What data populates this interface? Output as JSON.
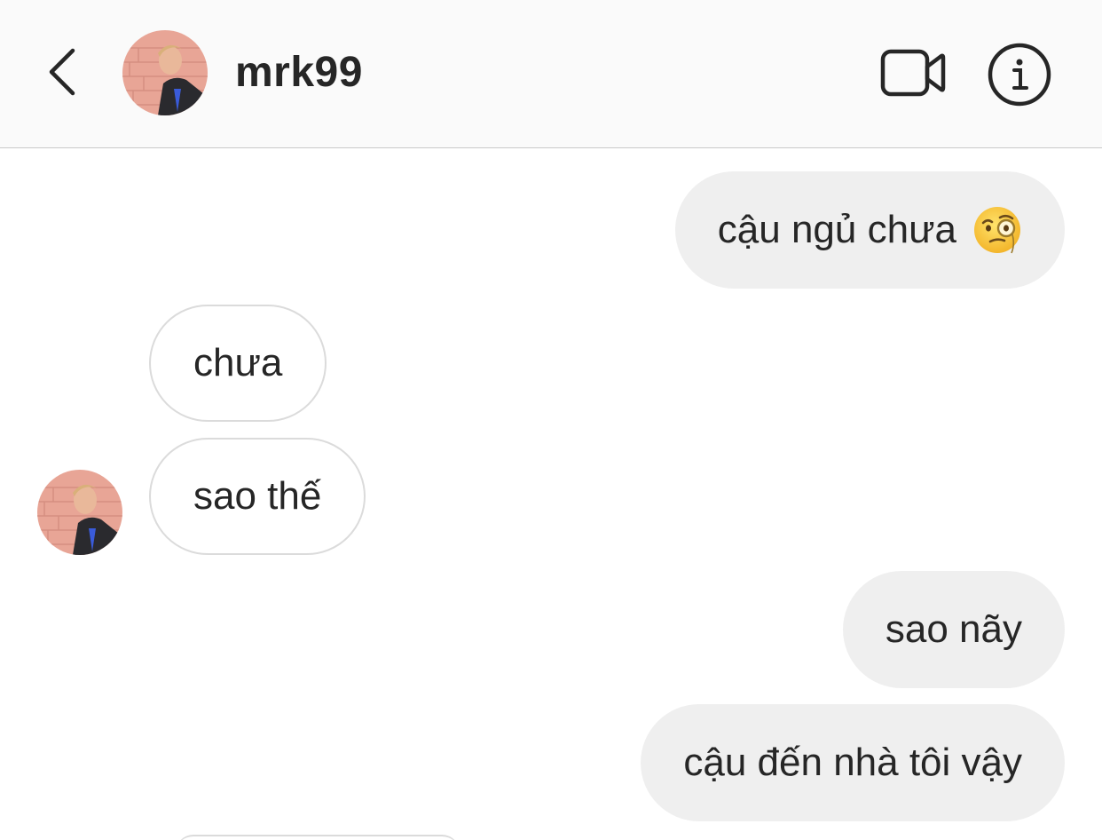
{
  "header": {
    "username": "mrk99",
    "back_icon": "chevron-left-icon",
    "video_icon": "video-camera-icon",
    "info_icon": "info-icon"
  },
  "messages": [
    {
      "direction": "sent",
      "text": "cậu ngủ chưa",
      "emoji": "face-with-monocle"
    },
    {
      "direction": "received",
      "text": "chưa"
    },
    {
      "direction": "received",
      "text": "sao thế"
    },
    {
      "direction": "sent",
      "text": "sao nãy"
    },
    {
      "direction": "sent",
      "text": "cậu đến nhà tôi vậy"
    }
  ],
  "colors": {
    "header_bg": "#fafafa",
    "sent_bubble": "#efefef",
    "received_border": "#dbdbdb",
    "text": "#262626"
  }
}
